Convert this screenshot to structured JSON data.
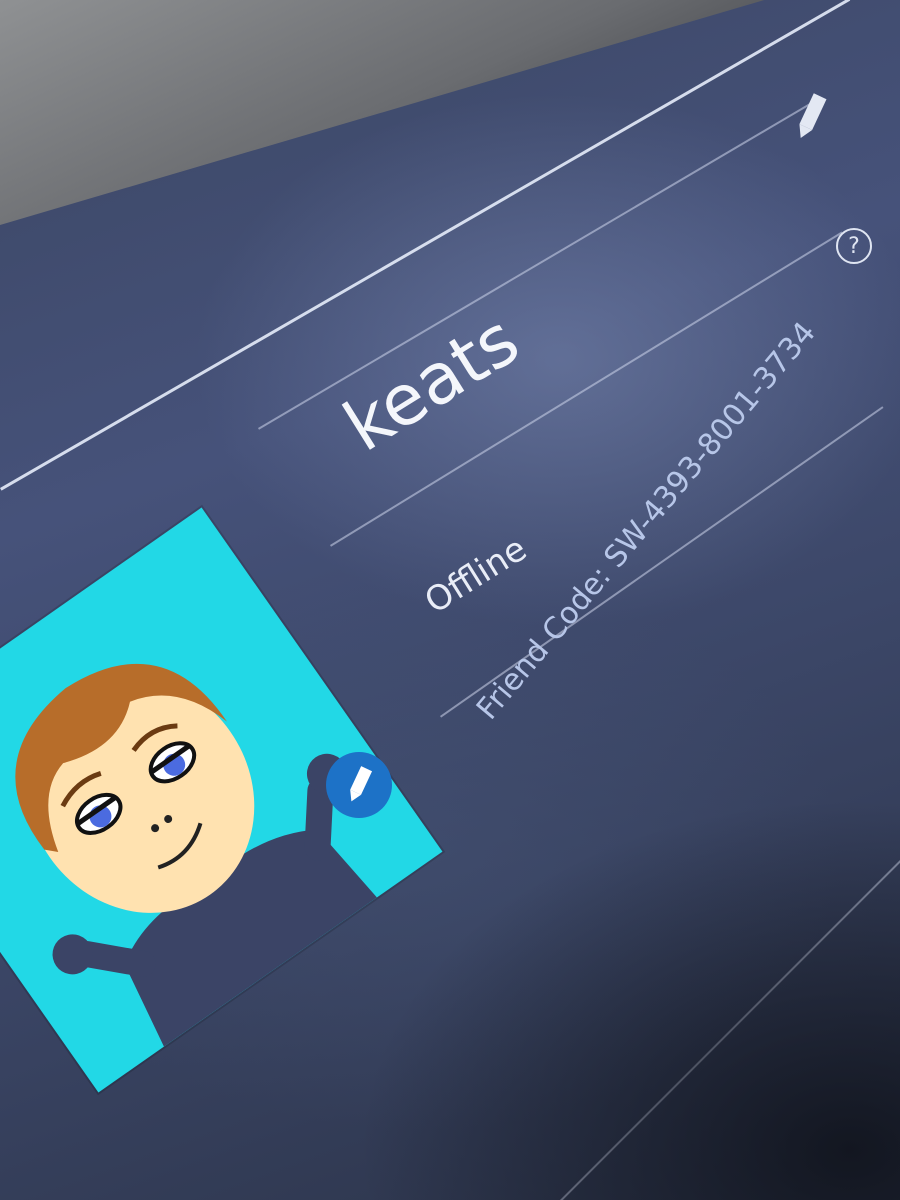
{
  "profile": {
    "username": "keats",
    "status": "Offline",
    "friend_code": "Friend Code: SW-4393-8001-3734"
  },
  "icons": {
    "edit_profile": "pencil-icon",
    "help": "question-mark-icon",
    "edit_avatar": "pencil-icon",
    "help_glyph": "?"
  },
  "colors": {
    "background": "#46527a",
    "avatar_background": "#22d8e6",
    "badge": "#1d72c7",
    "text": "#eef2fb",
    "friend_code_text": "#b7c6e8"
  }
}
